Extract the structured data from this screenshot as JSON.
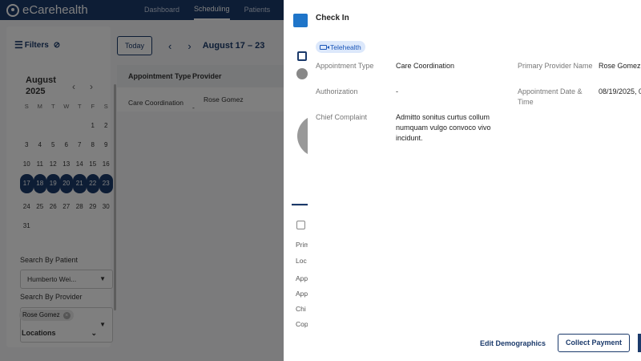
{
  "app": {
    "logo_text": "eCarehealth"
  },
  "nav": {
    "items": [
      "Dashboard",
      "Scheduling",
      "Patients"
    ],
    "active": "Scheduling"
  },
  "filters": {
    "title": "Filters",
    "calendar": {
      "month": "August",
      "year": "2025",
      "weekdays": [
        "S",
        "M",
        "T",
        "W",
        "T",
        "F",
        "S"
      ],
      "weeks": [
        [
          "",
          "",
          "",
          "",
          "",
          "1",
          "2"
        ],
        [
          "3",
          "4",
          "5",
          "6",
          "7",
          "8",
          "9"
        ],
        [
          "10",
          "11",
          "12",
          "13",
          "14",
          "15",
          "16"
        ],
        [
          "17",
          "18",
          "19",
          "20",
          "21",
          "22",
          "23"
        ],
        [
          "24",
          "25",
          "26",
          "27",
          "28",
          "29",
          "30"
        ],
        [
          "31",
          "",
          "",
          "",
          "",
          "",
          ""
        ]
      ],
      "selected_week_index": 3
    },
    "patient_label": "Search By Patient",
    "patient_value": "Humberto Wei...",
    "provider_label": "Search By Provider",
    "provider_chip": "Rose Gomez",
    "locations_label": "Locations"
  },
  "toolbar": {
    "today_label": "Today",
    "date_range": "August 17 – 23"
  },
  "table": {
    "headers": [
      "Appointment Type",
      "Provider"
    ],
    "rows": [
      {
        "type": "Care Coordination",
        "provider": "Rose Gomez",
        "extra": "-"
      }
    ]
  },
  "drawer_back": {
    "labels": [
      "Prim",
      "Loc",
      "App",
      "App",
      "Chi",
      "Cop"
    ]
  },
  "checkin": {
    "title": "Check In",
    "badge": "Telehealth",
    "fields": {
      "appointment_type_label": "Appointment Type",
      "appointment_type_value": "Care Coordination",
      "primary_provider_label": "Primary Provider Name",
      "primary_provider_value": "Rose Gomez",
      "authorization_label": "Authorization",
      "authorization_value": "-",
      "appointment_datetime_label": "Appointment Date & Time",
      "appointment_datetime_value": "08/19/2025, 0",
      "chief_complaint_label": "Chief Complaint",
      "chief_complaint_value": "Admitto sonitus curtus collum numquam vulgo convoco vivo incidunt."
    },
    "footer": {
      "edit_demographics": "Edit Demographics",
      "collect_payment": "Collect Payment"
    }
  }
}
